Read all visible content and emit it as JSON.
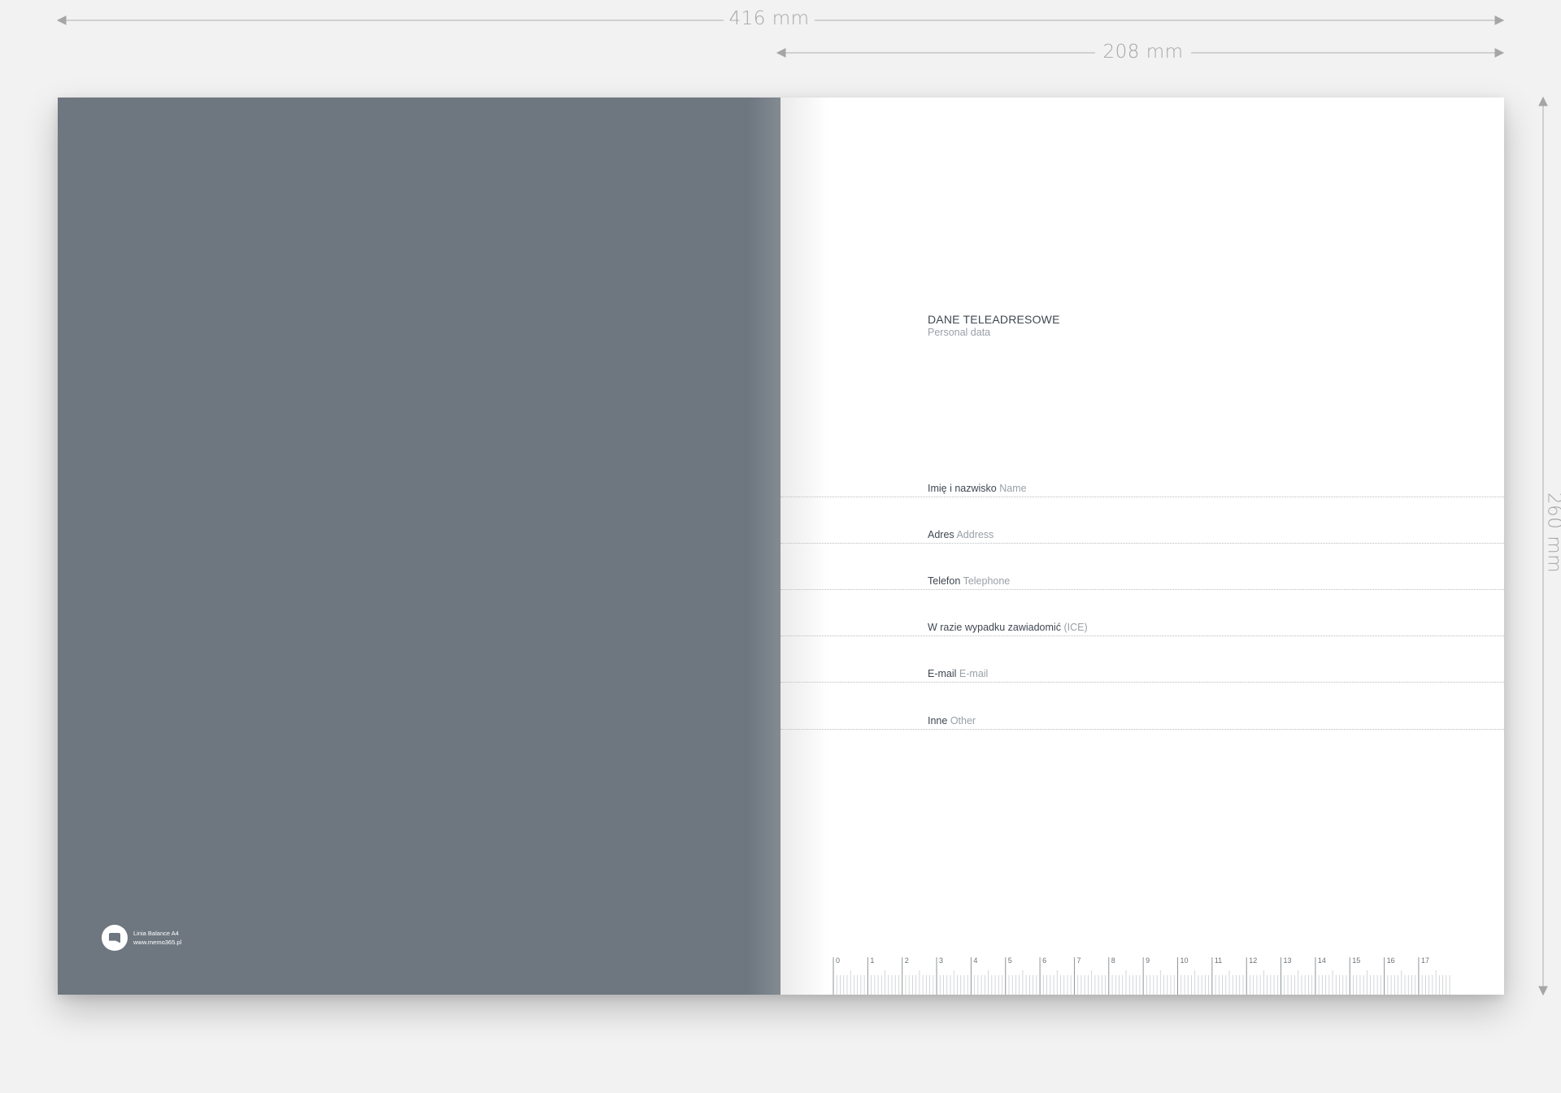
{
  "dimensions": {
    "spread_width": "416 mm",
    "page_width": "208 mm",
    "page_height": "260 mm"
  },
  "cover": {
    "brand_line1": "Linia Balance A4",
    "brand_line2": "www.memo365.pl",
    "color": "#6e7780"
  },
  "page": {
    "title": "DANE TELEADRESOWE",
    "subtitle": "Personal data",
    "fields": [
      {
        "pl": "Imię i nazwisko",
        "en": "Name"
      },
      {
        "pl": "Adres",
        "en": "Address"
      },
      {
        "pl": "Telefon",
        "en": "Telephone"
      },
      {
        "pl": "W razie wypadku zawiadomić",
        "en": "(ICE)"
      },
      {
        "pl": "E-mail",
        "en": "E-mail"
      },
      {
        "pl": "Inne",
        "en": "Other"
      }
    ]
  },
  "ruler": {
    "labels": [
      "0",
      "1",
      "2",
      "3",
      "4",
      "5",
      "6",
      "7",
      "8",
      "9",
      "10",
      "11",
      "12",
      "13",
      "14",
      "15",
      "16",
      "17"
    ]
  }
}
